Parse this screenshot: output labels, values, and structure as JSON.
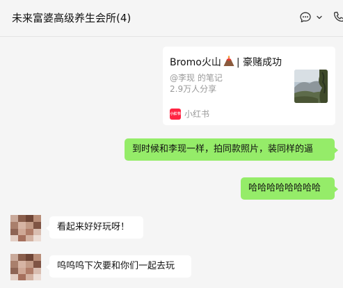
{
  "header": {
    "title": "未来富婆高级养生会所(4)",
    "more_icon": "chat-bubble-more-icon",
    "call_icon": "phone-icon"
  },
  "card": {
    "title_before": "Bromo火山",
    "title_after": "| 豪赌成功",
    "author": "@李现 的笔记",
    "shares": "2.9万人分享",
    "source": "小红书",
    "source_logo_text": "小红书"
  },
  "messages": [
    {
      "side": "mine",
      "text": "到时候和李现一样，拍同款照片，装同样的逼"
    },
    {
      "side": "mine",
      "text": "哈哈哈哈哈哈哈哈"
    },
    {
      "side": "theirs",
      "text": "看起来好好玩呀！"
    },
    {
      "side": "theirs",
      "text": "呜呜呜下次要和你们一起去玩"
    }
  ],
  "colors": {
    "my_bubble": "#95ec69",
    "their_bubble": "#ffffff",
    "background": "#f5f5f5",
    "xhs_brand": "#ff2442"
  }
}
